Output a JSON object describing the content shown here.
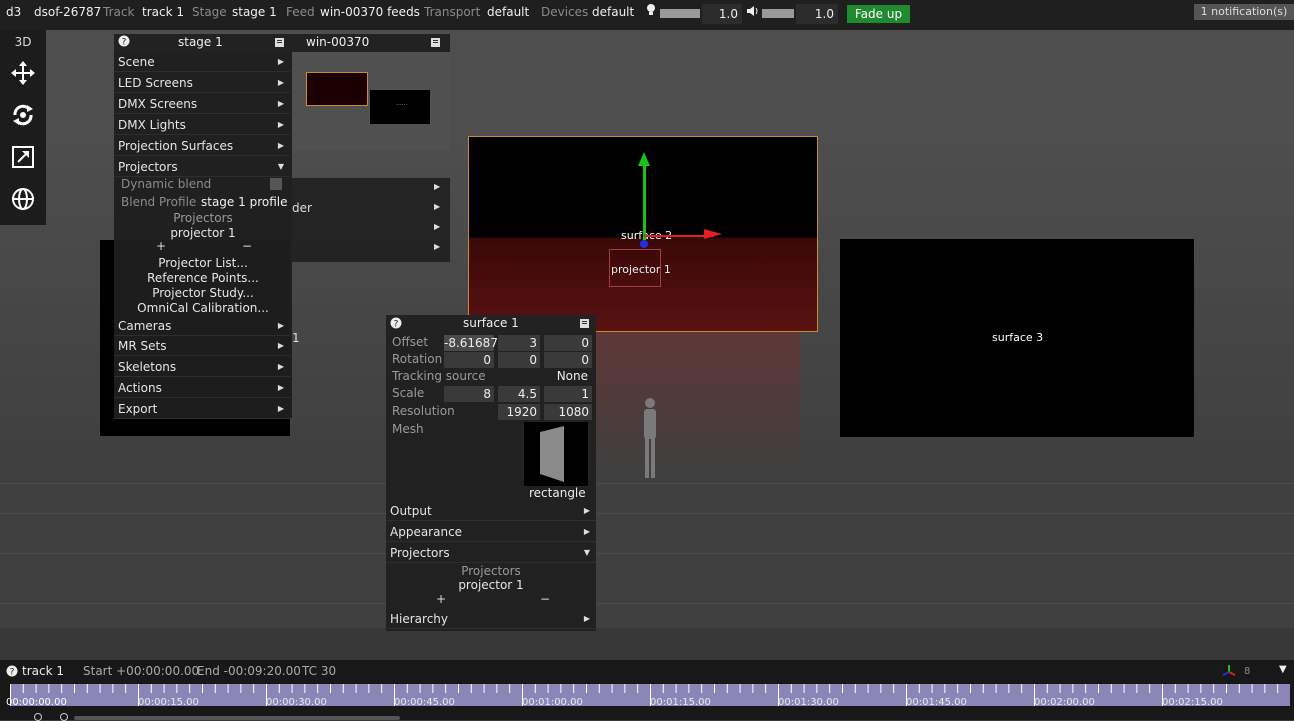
{
  "topbar": {
    "app": "d3",
    "project": "dsof-26787",
    "track_label": "Track",
    "track_value": "track 1",
    "stage_label": "Stage",
    "stage_value": "stage 1",
    "feed_label": "Feed",
    "feed_value": "win-00370 feeds",
    "transport_label": "Transport",
    "transport_value": "default",
    "devices_label": "Devices",
    "devices_value": "default",
    "brightness_value": "1.0",
    "volume_value": "1.0",
    "fade_button": "Fade up",
    "notifications": "1 notification(s)"
  },
  "viewport": {
    "mode_label": "3D",
    "stage_panel_title": "stage 1",
    "feed_panel_title": "win-00370",
    "thumb_label": "......",
    "surfaces": {
      "surface2": "surface 2",
      "surface3": "surface 3",
      "projector_label": "projector 1"
    },
    "partial_texts": {
      "der": "der",
      "one": "1"
    }
  },
  "stage_menu": {
    "items": [
      {
        "label": "Scene"
      },
      {
        "label": "LED Screens"
      },
      {
        "label": "DMX Screens"
      },
      {
        "label": "DMX Lights"
      },
      {
        "label": "Projection Surfaces"
      },
      {
        "label": "Projectors"
      }
    ],
    "projectors_section": {
      "dynamic_blend_label": "Dynamic blend",
      "blend_profile_label": "Blend Profile",
      "blend_profile_value": "stage 1 profile",
      "list_header": "Projectors",
      "list_item": "projector 1",
      "plus": "+",
      "minus": "−",
      "links": [
        "Projector List...",
        "Reference Points...",
        "Projector Study...",
        "OmniCal Calibration..."
      ]
    },
    "items_after": [
      {
        "label": "Cameras"
      },
      {
        "label": "MR Sets"
      },
      {
        "label": "Skeletons"
      },
      {
        "label": "Actions"
      },
      {
        "label": "Export"
      }
    ]
  },
  "surface_panel": {
    "title": "surface 1",
    "offset_label": "Offset",
    "offset": [
      "-8.61687",
      "3",
      "0"
    ],
    "rotation_label": "Rotation",
    "rotation": [
      "0",
      "0",
      "0"
    ],
    "tracking_label": "Tracking source",
    "tracking_value": "None",
    "scale_label": "Scale",
    "scale": [
      "8",
      "4.5",
      "1"
    ],
    "resolution_label": "Resolution",
    "resolution": [
      "1920",
      "1080"
    ],
    "mesh_label": "Mesh",
    "mesh_value": "rectangle",
    "sections": [
      "Output",
      "Appearance",
      "Projectors"
    ],
    "projectors_header": "Projectors",
    "projectors_item": "projector 1",
    "plus": "+",
    "minus": "−",
    "hierarchy": "Hierarchy"
  },
  "timeline": {
    "track": "track 1",
    "start": "Start +00:00:00.00",
    "end": "End -00:09:20.00",
    "tc": "TC 30",
    "current": "00:00:00.00",
    "ticks": [
      "00:00:15.00",
      "00:00:30.00",
      "00:00:45.00",
      "00:01:00.00",
      "00:01:15.00",
      "00:01:30.00",
      "00:01:45.00",
      "00:02:00.00",
      "00:02:15.00"
    ],
    "layers_count": "8"
  },
  "colors": {
    "fade_green": "#1f8a2e",
    "ruler": "#8c86b8",
    "projection_red": "#7a1010",
    "surface_border": "#c88a2a"
  }
}
